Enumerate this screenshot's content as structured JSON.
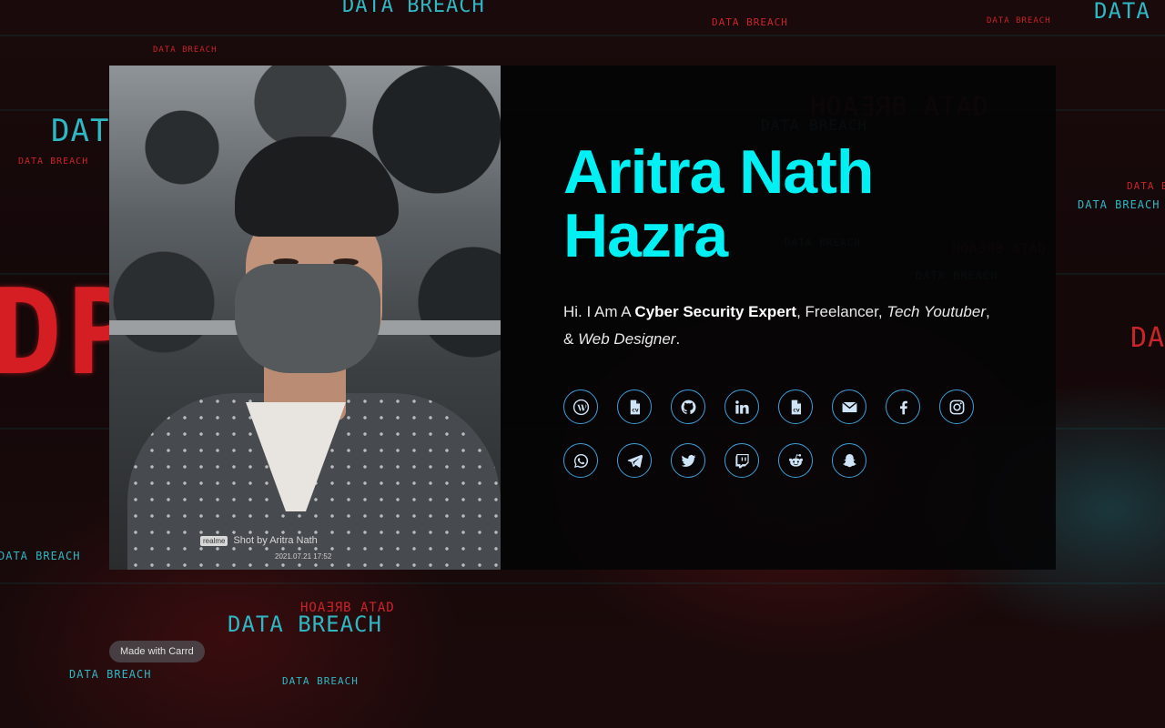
{
  "profile": {
    "name_line1": "Aritra Nath",
    "name_line2": "Hazra",
    "photo": {
      "watermark_brand": "realme",
      "watermark_text": "Shot by Aritra Nath",
      "watermark_time": "2021.07.21 17:52"
    }
  },
  "bio": {
    "intro": "Hi. I Am A ",
    "role_main": "Cyber Security Expert",
    "sep1": ", Freelancer, ",
    "role_youtube": "Tech Youtuber",
    "sep2": ", & ",
    "role_web": "Web Designer",
    "end": "."
  },
  "social_links": [
    {
      "name": "wordpress-icon"
    },
    {
      "name": "cv-icon"
    },
    {
      "name": "github-icon"
    },
    {
      "name": "linkedin-icon"
    },
    {
      "name": "cv-icon"
    },
    {
      "name": "email-icon"
    },
    {
      "name": "facebook-icon"
    },
    {
      "name": "instagram-icon"
    },
    {
      "name": "whatsapp-icon"
    },
    {
      "name": "telegram-icon"
    },
    {
      "name": "twitter-icon"
    },
    {
      "name": "twitch-icon"
    },
    {
      "name": "reddit-icon"
    },
    {
      "name": "snapchat-icon"
    }
  ],
  "footer": {
    "made_with": "Made with Carrd"
  },
  "background_words": {
    "breach": "DATA BREACH",
    "breach_mirrored": "HOAƎЯB ATAD",
    "data": "DATA",
    "data_short": "DAT",
    "big_red": "DP"
  },
  "colors": {
    "name_accent": "#00f0f4",
    "icon_border": "#3e9fd8",
    "card_background": "#050506"
  }
}
